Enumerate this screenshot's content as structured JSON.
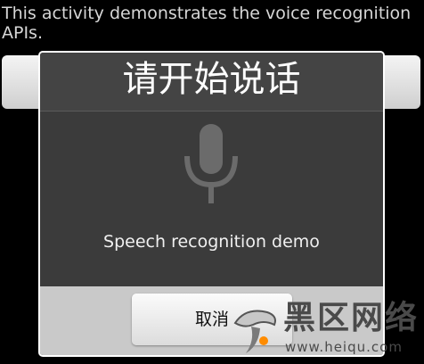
{
  "activity": {
    "description": "This activity demonstrates the voice recognition APIs."
  },
  "dialog": {
    "title": "请开始说话",
    "message": "Speech recognition demo",
    "cancel_label": "取消",
    "icon": "microphone-icon"
  },
  "watermark": {
    "text": "黑区网络",
    "url": "www.heiqu.com"
  },
  "colors": {
    "background": "#000000",
    "dialog_bg": "#3b3b3b",
    "dialog_footer": "#c9c9c9",
    "title_text": "#ffffff"
  }
}
